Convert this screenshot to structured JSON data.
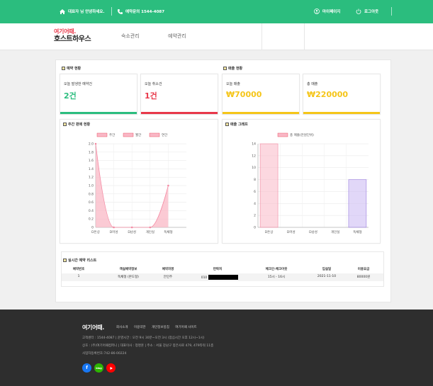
{
  "topbar": {
    "welcome": "대표자 님 안녕하세요.",
    "contact": "예약문의 1544-4087",
    "mypage": "마이페이지",
    "logout": "로그아웃"
  },
  "brand": {
    "logo_top": "여기어때.",
    "logo_bottom": "호스트하우스"
  },
  "nav": {
    "item1": "숙소관리",
    "item2": "예약관리"
  },
  "reservation_status": {
    "title": "예약 현황",
    "new_label": "오늘 발생한 예약건",
    "new_value": "2건",
    "cancel_label": "오늘 취소건",
    "cancel_value": "1건"
  },
  "sales_status": {
    "title": "매출 현황",
    "today_label": "오늘 매출",
    "today_value": "₩70000",
    "total_label": "총 매출",
    "total_value": "₩220000"
  },
  "colors": {
    "green": "#2bbd7e",
    "red": "#e8384a",
    "yellow": "#f5c518",
    "pink": "#f9b8c6",
    "purple": "#c9b6f2"
  },
  "weekly_chart": {
    "title": "주간 판매 현황",
    "chart_data": {
      "type": "area",
      "legend": [
        "주간",
        "월간",
        "연간"
      ],
      "categories": [
        "D돈상",
        "D머성",
        "D남성",
        "개인실",
        "독채형"
      ],
      "values": [
        2.0,
        0,
        0,
        0,
        1.0
      ],
      "yticks": [
        "2.0",
        "1.8",
        "1.6",
        "1.4",
        "1.2",
        "1.0",
        "0.8",
        "0.6",
        "0.4",
        "0.2",
        "0"
      ],
      "ylim": [
        0,
        2
      ]
    }
  },
  "sales_chart": {
    "title": "매출 그래프",
    "chart_data": {
      "type": "bar",
      "legend": [
        "총 매출(만원단위)"
      ],
      "categories": [
        "D돈상",
        "D머성",
        "D남성",
        "개인실",
        "독채형"
      ],
      "values": [
        14,
        0,
        0,
        0,
        8
      ],
      "yticks": [
        "14",
        "12",
        "10",
        "8",
        "6",
        "4",
        "2",
        "0"
      ],
      "ylim": [
        0,
        14
      ]
    }
  },
  "realtime": {
    "title": "실시간 예약 리스트",
    "headers": [
      "예약번호",
      "객실예약정보",
      "예약자명",
      "연락처",
      "체크인-체크아웃",
      "입실일",
      "이용요금"
    ],
    "rows": [
      {
        "no": "1",
        "room": "독채형 (본도형)",
        "name": "안민주",
        "phone": "010",
        "checkin": "15시 - 16시",
        "date": "2021-11-10",
        "price": "80000원"
      }
    ]
  },
  "footer": {
    "logo": "여기어때.",
    "links": [
      "회사소개",
      "이용약관",
      "개인정보방침",
      "여기어때 사이트"
    ],
    "line1": "고객센터 : 1544-4087  |  운영시간 : 오전 9시 30분~오전 3시 (점심시간 오후 12시~1시)",
    "line2": "상호 : (주)여기어때컴퍼니  |  대표이사 : 정명훈  |  주소 : 서울 강남구 봉은사로 479, 479타워 11층",
    "line3": "사업자등록번호:742-86-00224",
    "sns": {
      "blog": "blog"
    }
  }
}
